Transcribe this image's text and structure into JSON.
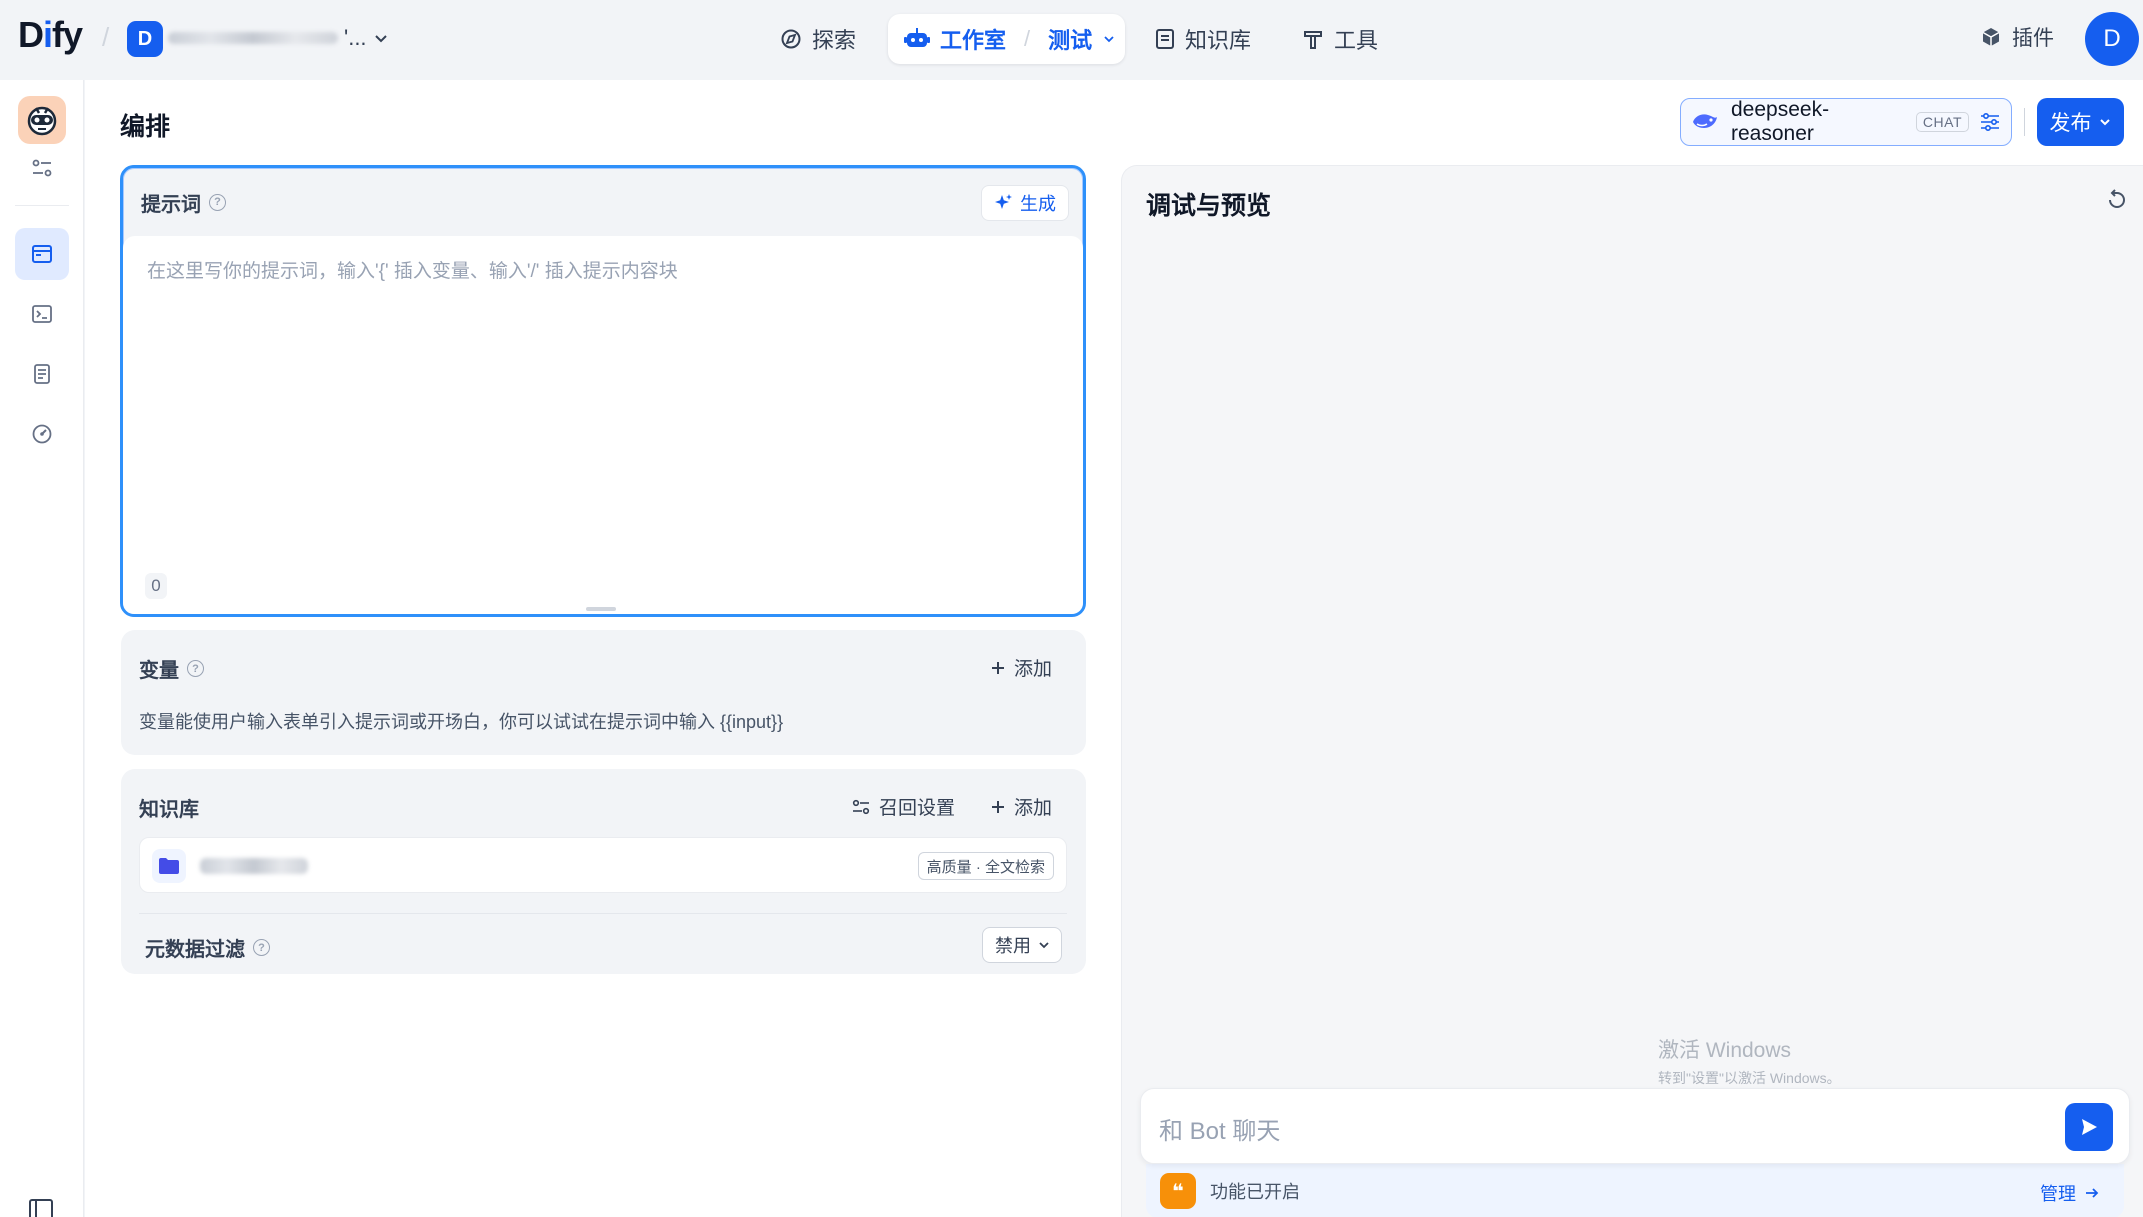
{
  "header": {
    "logo": "Dify",
    "workspace_initial": "D",
    "workspace_suffix": "'...",
    "nav": {
      "explore": "探索",
      "studio": "工作室",
      "current_app": "测试",
      "knowledge": "知识库",
      "tools": "工具"
    },
    "plugins": "插件",
    "user_initial": "D"
  },
  "page": {
    "title": "编排",
    "model": {
      "name": "deepseek-reasoner",
      "mode_badge": "CHAT"
    },
    "publish_label": "发布"
  },
  "prompt": {
    "title": "提示词",
    "generate_label": "生成",
    "placeholder": "在这里写你的提示词，输入'{' 插入变量、输入'/' 插入提示内容块",
    "char_count": "0"
  },
  "variables": {
    "title": "变量",
    "add_label": "添加",
    "description": "变量能使用户输入表单引入提示词或开场白，你可以试试在提示词中输入 {{input}}"
  },
  "knowledge": {
    "title": "知识库",
    "recall_settings_label": "召回设置",
    "add_label": "添加",
    "item_tag": "高质量 · 全文检索",
    "metadata_filter_title": "元数据过滤",
    "metadata_filter_value": "禁用"
  },
  "debug": {
    "title": "调试与预览",
    "chat_placeholder": "和 Bot 聊天",
    "features_enabled": "功能已开启",
    "manage_label": "管理"
  },
  "system_watermark": {
    "line1": "激活 Windows",
    "line2": "转到\"设置\"以激活 Windows。"
  },
  "colors": {
    "brand": "#155eef",
    "prompt_border": "#2e90fa",
    "feature_icon": "#f79009",
    "app_icon_bg": "#fbd2b8"
  }
}
